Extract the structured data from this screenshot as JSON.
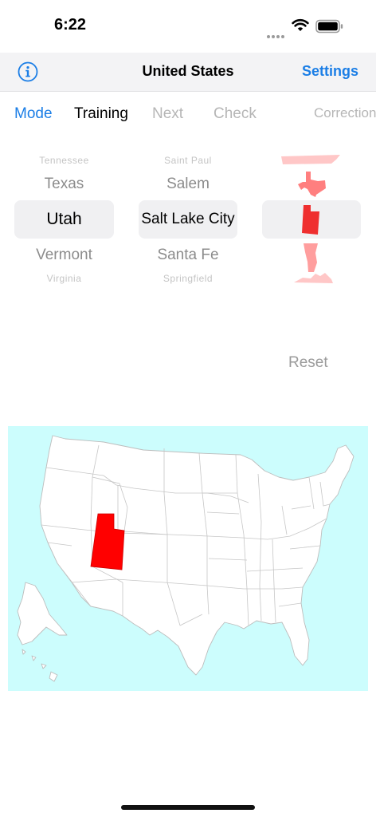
{
  "status_bar": {
    "time": "6:22"
  },
  "navbar": {
    "title": "United States",
    "settings_label": "Settings"
  },
  "toolbar": {
    "mode_label": "Mode",
    "training_label": "Training",
    "next_label": "Next",
    "check_label": "Check",
    "correction_label": "Correction"
  },
  "picker": {
    "states": [
      "Tennessee",
      "Texas",
      "Utah",
      "Vermont",
      "Virginia"
    ],
    "capitals": [
      "Saint Paul",
      "Salem",
      "Salt Lake City",
      "Santa Fe",
      "Springfield"
    ],
    "selected_index": 2
  },
  "reset_label": "Reset",
  "colors": {
    "accent": "#1b7ee6",
    "highlight_state": "#ff0000",
    "water": "#ccfdfd"
  }
}
